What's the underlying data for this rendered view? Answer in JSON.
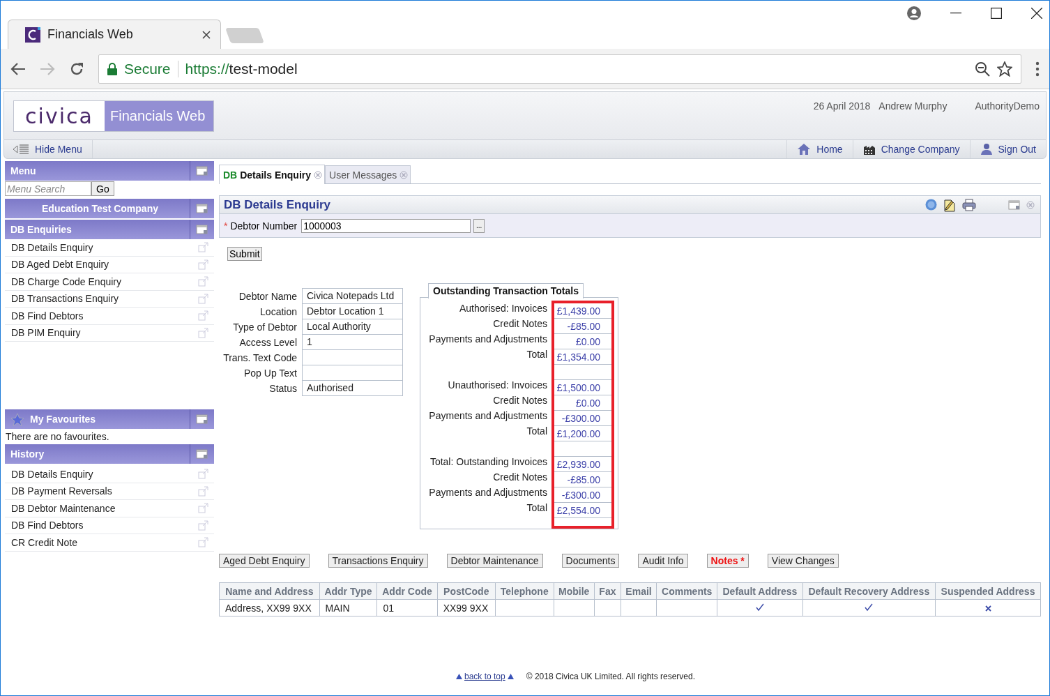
{
  "browser": {
    "tab_title": "Financials Web",
    "secure_label": "Secure",
    "url_scheme": "https://",
    "url_host": "test-model"
  },
  "header": {
    "logo": "civica",
    "product": "Financials Web",
    "date": "26 April 2018",
    "user": "Andrew Murphy",
    "authority": "AuthorityDemo"
  },
  "navbar": {
    "hide_menu": "Hide Menu",
    "links": [
      {
        "kind": "home",
        "label": "Home"
      },
      {
        "kind": "company",
        "label": "Change Company"
      },
      {
        "kind": "signout",
        "label": "Sign Out"
      }
    ]
  },
  "sidebar": {
    "menu_title": "Menu",
    "search_placeholder": "Menu Search",
    "go": "Go",
    "company": "Education Test Company",
    "section": "DB Enquiries",
    "items": [
      "DB Details Enquiry",
      "DB Aged Debt Enquiry",
      "DB Charge Code Enquiry",
      "DB Transactions Enquiry",
      "DB Find Debtors",
      "DB PIM Enquiry"
    ],
    "favourites_title": "My Favourites",
    "favourites_empty": "There are no favourites.",
    "history_title": "History",
    "history_items": [
      "DB Details Enquiry",
      "DB Payment Reversals",
      "DB Debtor Maintenance",
      "DB Find Debtors",
      "CR Credit Note"
    ]
  },
  "tabs": [
    {
      "prefix": "DB",
      "label": "Details Enquiry",
      "selected": true
    },
    {
      "label": "User Messages",
      "selected": false
    }
  ],
  "panel": {
    "title": "DB Details Enquiry",
    "required_marker": "*",
    "debtor_label": "Debtor Number",
    "debtor_value": "1000003",
    "browse": "...",
    "submit": "Submit"
  },
  "details": [
    {
      "label": "Debtor Name",
      "value": "Civica Notepads Ltd"
    },
    {
      "label": "Location",
      "value": "Debtor Location 1"
    },
    {
      "label": "Type of Debtor",
      "value": "Local Authority"
    },
    {
      "label": "Access Level",
      "value": "1"
    },
    {
      "label": "Trans. Text Code"
    },
    {
      "label": "Pop Up Text"
    },
    {
      "label": "Status",
      "value": "Authorised"
    }
  ],
  "totals": {
    "title": "Outstanding Transaction Totals",
    "highlighted": true,
    "rows": [
      {
        "kind": "row",
        "label": "Authorised: Invoices",
        "value": "£1,439.00"
      },
      {
        "kind": "row",
        "label": "Credit Notes",
        "value": "-£85.00"
      },
      {
        "kind": "row",
        "label": "Payments and Adjustments",
        "value": "£0.00"
      },
      {
        "kind": "row",
        "label": "Total",
        "value": "£1,354.00"
      },
      {
        "kind": "spacer"
      },
      {
        "kind": "row",
        "label": "Unauthorised: Invoices",
        "value": "£1,500.00"
      },
      {
        "kind": "row",
        "label": "Credit Notes",
        "value": "£0.00"
      },
      {
        "kind": "row",
        "label": "Payments and Adjustments",
        "value": "-£300.00"
      },
      {
        "kind": "row",
        "label": "Total",
        "value": "£1,200.00"
      },
      {
        "kind": "spacer"
      },
      {
        "kind": "row",
        "label": "Total: Outstanding Invoices",
        "value": "£2,939.00"
      },
      {
        "kind": "row",
        "label": "Credit Notes",
        "value": "-£85.00"
      },
      {
        "kind": "row",
        "label": "Payments and Adjustments",
        "value": "-£300.00"
      },
      {
        "kind": "row",
        "label": "Total",
        "value": "£2,554.00"
      }
    ]
  },
  "actions": [
    {
      "label": "Aged Debt Enquiry",
      "kind": "normal"
    },
    {
      "label": "Transactions Enquiry",
      "kind": "normal"
    },
    {
      "label": "Debtor Maintenance",
      "kind": "normal"
    },
    {
      "label": "Documents",
      "kind": "normal"
    },
    {
      "label": "Audit Info",
      "kind": "normal"
    },
    {
      "label": "Notes *",
      "kind": "alert"
    },
    {
      "label": "View Changes",
      "kind": "normal"
    }
  ],
  "addresses": {
    "columns": [
      "Name and Address",
      "Addr Type",
      "Addr Code",
      "PostCode",
      "Telephone",
      "Mobile",
      "Fax",
      "Email",
      "Comments",
      "Default Address",
      "Default Recovery Address",
      "Suspended Address"
    ],
    "rows": [
      {
        "cells": [
          "Address, XX99 9XX",
          "MAIN",
          "01",
          "XX99 9XX",
          "",
          "",
          "",
          "",
          ""
        ],
        "default_address": true,
        "default_recovery": true,
        "suspended": false
      }
    ]
  },
  "footer": {
    "back_to_top": "back to top",
    "copyright": "© 2018 Civica UK Limited. All rights reserved."
  }
}
